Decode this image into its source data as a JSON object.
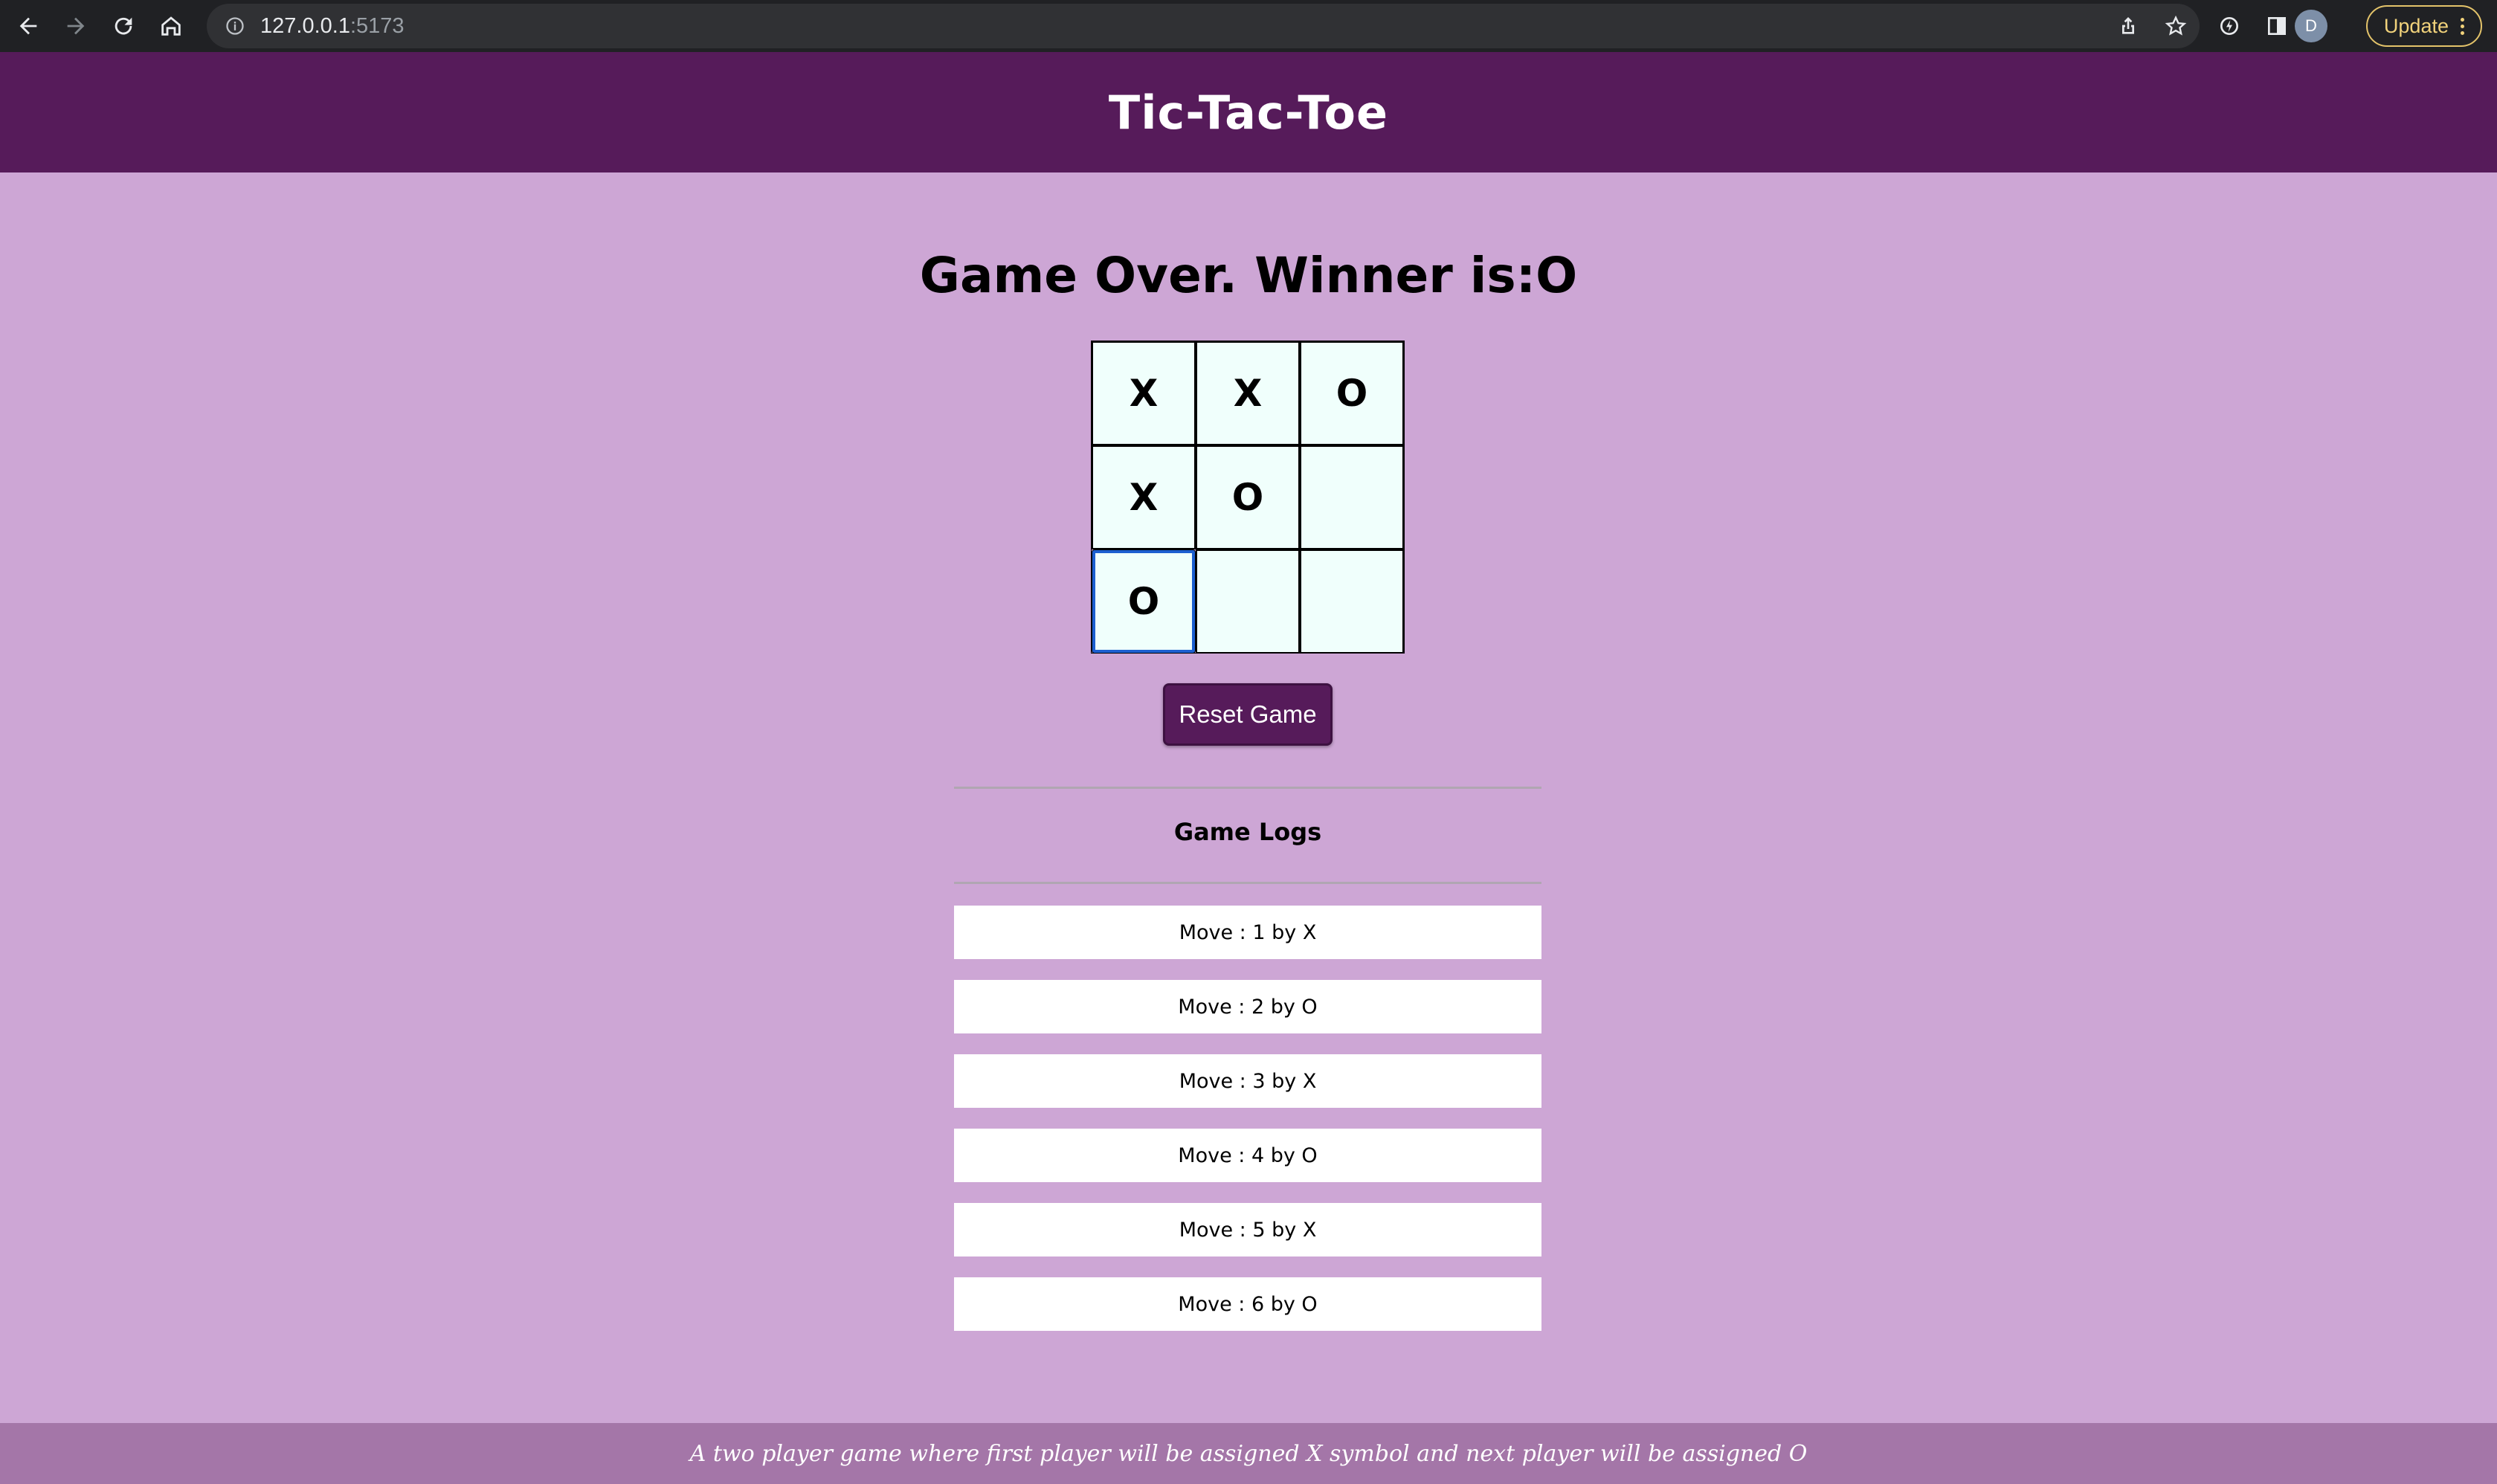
{
  "browser": {
    "url_host": "127.0.0.1",
    "url_port": ":5173",
    "avatar_initial": "D",
    "update_label": "Update"
  },
  "app": {
    "title": "Tic-Tac-Toe",
    "status": "Game Over. Winner is:O"
  },
  "board": {
    "cells": [
      "X",
      "X",
      "O",
      "X",
      "O",
      "",
      "O",
      "",
      ""
    ],
    "focused_cell_index": 6
  },
  "reset_label": "Reset Game",
  "logs": {
    "title": "Game Logs",
    "items": [
      "Move : 1 by X",
      "Move : 2 by O",
      "Move : 3 by X",
      "Move : 4 by O",
      "Move : 5 by X",
      "Move : 6 by O"
    ]
  },
  "footer_text": "A two player game where first player will be assigned X symbol and next player will be assigned O",
  "colors": {
    "header": "#561b5a",
    "background": "#cda6d5",
    "cell": "#f0fffc",
    "footer": "#a476a8"
  },
  "icons": [
    "back-arrow-icon",
    "forward-arrow-icon",
    "reload-icon",
    "home-icon",
    "info-icon",
    "share-icon",
    "star-icon",
    "extension-icon",
    "sidebar-icon",
    "kebab-menu-icon"
  ]
}
